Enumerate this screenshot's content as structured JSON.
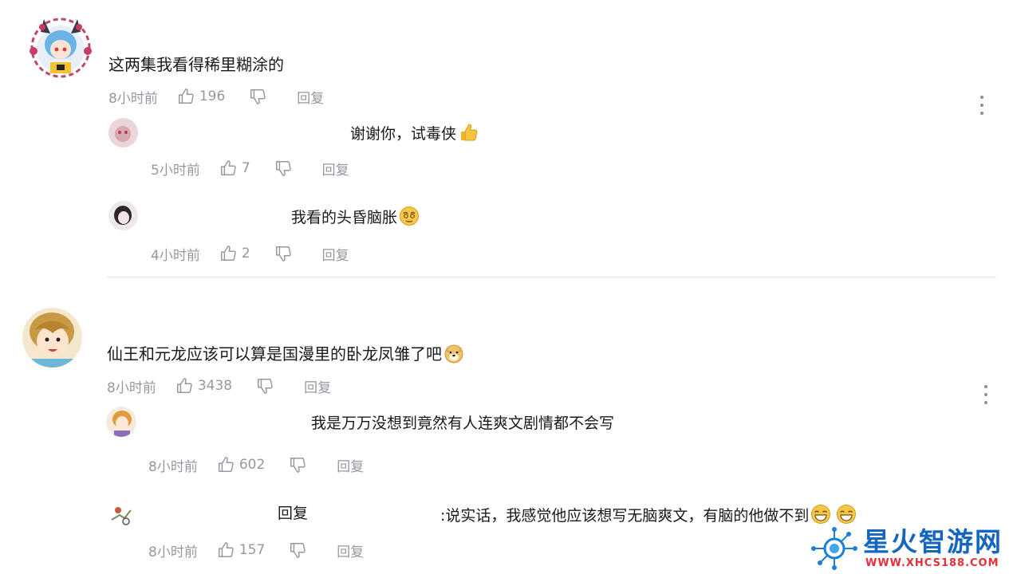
{
  "comments": [
    {
      "text": "这两集我看得稀里糊涂的",
      "time": "8小时前",
      "likes": "196",
      "reply_label": "回复",
      "replies": [
        {
          "text": "谢谢你，试毒侠",
          "emoji": "thumbs-up",
          "time": "5小时前",
          "likes": "7",
          "reply_label": "回复"
        },
        {
          "text": "我看的头昏脑胀",
          "emoji": "dizzy-face",
          "time": "4小时前",
          "likes": "2",
          "reply_label": "回复"
        }
      ]
    },
    {
      "text": "仙王和元龙应该可以算是国漫里的卧龙凤雏了吧",
      "emoji": "doge",
      "time": "8小时前",
      "likes": "3438",
      "reply_label": "回复",
      "replies": [
        {
          "text": "我是万万没想到竟然有人连爽文剧情都不会写",
          "time": "8小时前",
          "likes": "602",
          "reply_label": "回复"
        },
        {
          "prefix": "回复",
          "text": ":说实话，我感觉他应该想写无脑爽文，有脑的他做不到",
          "emoji": "grin-squint",
          "time": "8小时前",
          "likes": "157",
          "reply_label": "回复"
        }
      ]
    }
  ],
  "watermark": {
    "title": "星火智游网",
    "url": "WWW.XHCS188.COM"
  },
  "colors": {
    "meta": "#9499a0",
    "text": "#18191c",
    "divider": "#e3e5e7",
    "watermark_blue": "#1c7fd6",
    "watermark_red": "#e5303a"
  }
}
